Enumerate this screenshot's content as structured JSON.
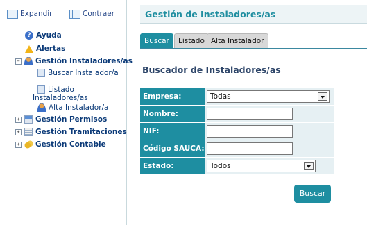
{
  "sidebar": {
    "expand_label": "Expandir",
    "collapse_label": "Contraer",
    "items": [
      {
        "label": "Ayuda",
        "icon": "help-icon"
      },
      {
        "label": "Alertas",
        "icon": "alert-icon"
      },
      {
        "label": "Gestión Instaladores/as",
        "icon": "installer-icon",
        "expanded": true,
        "children": [
          {
            "label": "Buscar Instalador/a",
            "icon": "document-icon"
          },
          {
            "label": "Listado Instaladores/as",
            "icon": "document-icon"
          },
          {
            "label": "Alta Instalador/a",
            "icon": "add-user-icon"
          }
        ]
      },
      {
        "label": "Gestión Permisos",
        "icon": "id-card-icon"
      },
      {
        "label": "Gestión Tramitaciones",
        "icon": "list-icon"
      },
      {
        "label": "Gestión Contable",
        "icon": "coins-icon"
      }
    ]
  },
  "main": {
    "title": "Gestión de Instaladores/as",
    "tabs": [
      {
        "label": "Buscar",
        "active": true
      },
      {
        "label": "Listado",
        "active": false
      },
      {
        "label": "Alta Instalador",
        "active": false
      }
    ],
    "form_title": "Buscador de Instaladores/as",
    "fields": {
      "empresa": {
        "label": "Empresa:",
        "value": "Todas"
      },
      "nombre": {
        "label": "Nombre:",
        "value": ""
      },
      "nif": {
        "label": "NIF:",
        "value": ""
      },
      "codigo": {
        "label": "Código SAUCA:",
        "value": ""
      },
      "estado": {
        "label": "Estado:",
        "value": "Todos"
      }
    },
    "search_button": "Buscar"
  },
  "colors": {
    "accent": "#1e8ea1",
    "title": "#1f8ea0",
    "text": "#0b3a78"
  }
}
